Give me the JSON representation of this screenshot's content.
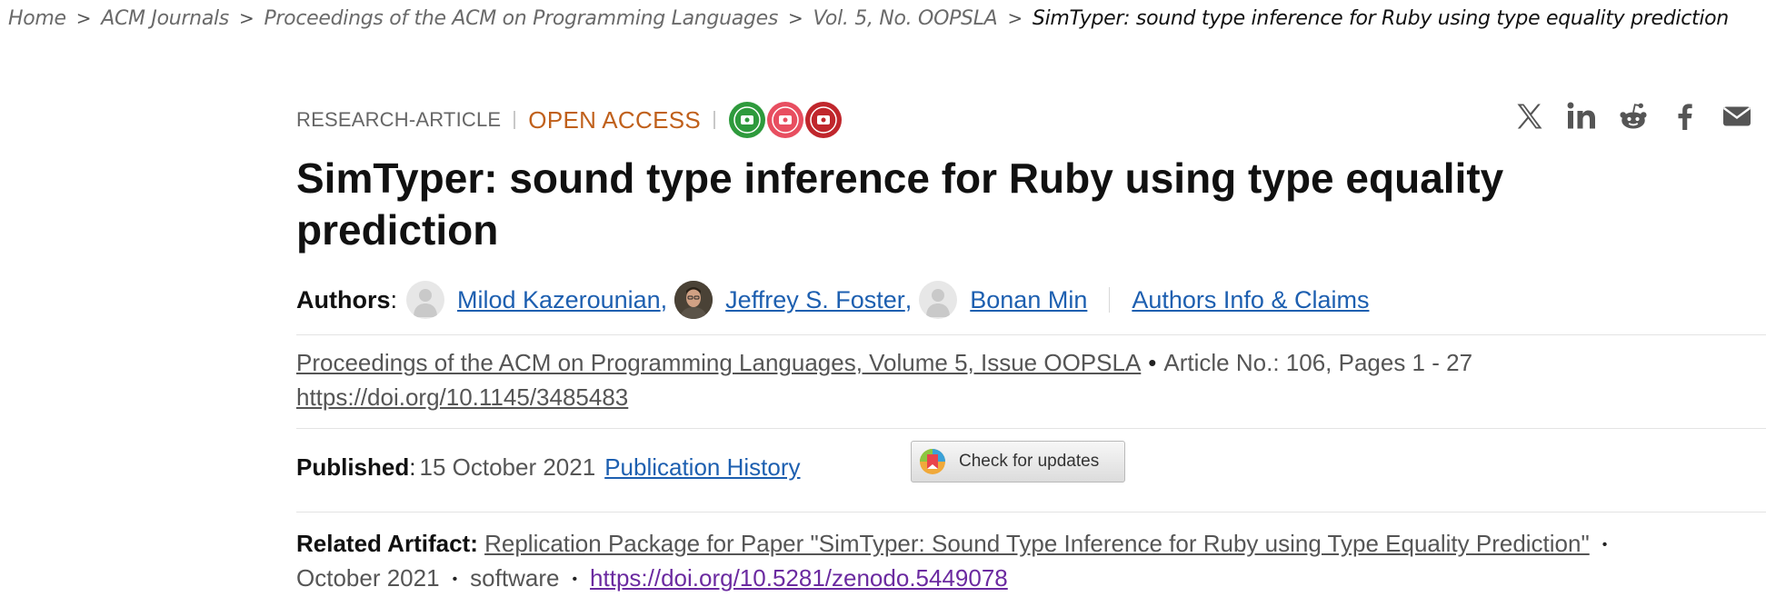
{
  "breadcrumb": {
    "items": [
      "Home",
      "ACM Journals",
      "Proceedings of the ACM on Programming Languages",
      "Vol. 5, No. OOPSLA"
    ],
    "current": "SimTyper: sound type inference for Ruby using type equality prediction",
    "separator": ">"
  },
  "article": {
    "type": "RESEARCH-ARTICLE",
    "access": "OPEN ACCESS",
    "badges": [
      {
        "color": "#2e9a3c"
      },
      {
        "color": "#e84e60"
      },
      {
        "color": "#c0262c"
      }
    ],
    "title": "SimTyper: sound type inference for Ruby using type equality prediction"
  },
  "share": {
    "icons": [
      "x-icon",
      "linkedin-icon",
      "reddit-icon",
      "facebook-icon",
      "email-icon"
    ]
  },
  "authors": {
    "label": "Authors",
    "colon": ":",
    "list": [
      {
        "name": "Milod Kazerounian",
        "sep": ","
      },
      {
        "name": "Jeffrey S. Foster",
        "sep": ","
      },
      {
        "name": "Bonan Min",
        "sep": ""
      }
    ],
    "info_link": "Authors Info & Claims"
  },
  "citation": {
    "journal": "Proceedings of the ACM on Programming Languages, Volume 5, Issue OOPSLA",
    "bullet": "•",
    "article_info": "Article No.: 106, Pages 1 - 27",
    "doi": "https://doi.org/10.1145/3485483"
  },
  "published": {
    "label": "Published",
    "colon": ":",
    "date": "15 October 2021",
    "history_link": "Publication History"
  },
  "update_button": {
    "label": "Check for updates"
  },
  "related": {
    "label": "Related Artifact:",
    "title": "Replication Package for Paper \"SimTyper: Sound Type Inference for Ruby using Type Equality Prediction\"",
    "date": "October 2021",
    "kind": "software",
    "doi": "https://doi.org/10.5281/zenodo.5449078",
    "bullet": "•"
  }
}
